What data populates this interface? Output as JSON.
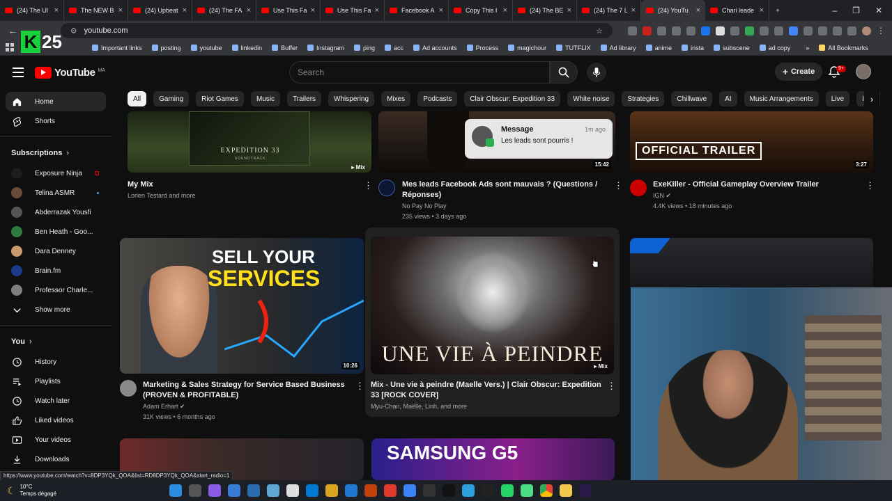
{
  "tabs": [
    {
      "title": "(24) The Ul"
    },
    {
      "title": "The NEW B"
    },
    {
      "title": "(24) Upbeat"
    },
    {
      "title": "(24) The FA"
    },
    {
      "title": "Use This Fa"
    },
    {
      "title": "Use This Fa"
    },
    {
      "title": "Facebook A"
    },
    {
      "title": "Copy This I"
    },
    {
      "title": "(24) The BE"
    },
    {
      "title": "(24) The 7 L"
    },
    {
      "title": "(24) YouTu"
    },
    {
      "title": "Chari leade"
    }
  ],
  "browser": {
    "url": "youtube.com",
    "new_tab": "+",
    "bookmarks": [
      "Important links",
      "posting",
      "youtube",
      "linkedin",
      "Buffer",
      "Instagram",
      "ping",
      "acc",
      "Ad accounts",
      "Process",
      "magichour",
      "TUTFLIX",
      "Ad library",
      "anime",
      "insta",
      "subscene",
      "ad copy"
    ],
    "all_bookmarks": "All Bookmarks",
    "more": "»"
  },
  "overlay": {
    "k": "K",
    "num": "25"
  },
  "youtube": {
    "logo": "YouTube",
    "country": "MA",
    "search_placeholder": "Search",
    "create": "Create",
    "notif_count": "9+"
  },
  "sidebar": {
    "home": "Home",
    "shorts": "Shorts",
    "subscriptions": "Subscriptions",
    "channels": [
      {
        "name": "Exposure Ninja",
        "color": "#1d1d1d"
      },
      {
        "name": "Telina ASMR",
        "color": "#6a4c3b"
      },
      {
        "name": "Abderrazak Yousfi",
        "color": "#555555"
      },
      {
        "name": "Ben Heath - Goo...",
        "color": "#2d7a3e"
      },
      {
        "name": "Dara Denney",
        "color": "#c89b6d"
      },
      {
        "name": "Brain.fm",
        "color": "#1b3a8a"
      },
      {
        "name": "Professor Charle...",
        "color": "#7d7d7d"
      }
    ],
    "show_more": "Show more",
    "you": "You",
    "history": "History",
    "playlists": "Playlists",
    "watch_later": "Watch later",
    "liked_videos": "Liked videos",
    "your_videos": "Your videos",
    "downloads": "Downloads"
  },
  "chips": [
    "All",
    "Gaming",
    "Riot Games",
    "Music",
    "Trailers",
    "Whispering",
    "Mixes",
    "Podcasts",
    "Clair Obscur: Expedition 33",
    "White noise",
    "Strategies",
    "Chillwave",
    "AI",
    "Music Arrangements",
    "Live",
    "Ideas"
  ],
  "videos": {
    "v1": {
      "title": "My Mix",
      "meta1": "Lorien Testard and more",
      "badge": "Mix",
      "thumb_text": "EXPEDITION 33",
      "thumb_sub": "SOUNDTRACK"
    },
    "v2": {
      "title": "Mes leads Facebook Ads sont mauvais ? (Questions / Réponses)",
      "channel": "No Pay No Play",
      "meta": "235 views • 3 days ago",
      "duration": "15:42"
    },
    "v3": {
      "title": "ExeKiller - Official Gameplay Overview Trailer",
      "channel": "IGN",
      "meta": "4.4K views • 18 minutes ago",
      "duration": "3:27",
      "thumb_text": "OFFICIAL TRAILER"
    },
    "v4": {
      "title": "Marketing & Sales Strategy for Service Based Business (PROVEN & PROFITABLE)",
      "channel": "Adam Erhart",
      "meta": "31K views • 6 months ago",
      "duration": "10:26",
      "thumb_line1": "SELL YOUR",
      "thumb_line2": "SERVICES"
    },
    "v5": {
      "title": "Mix - Une vie à peindre (Maelle Vers.) | Clair Obscur: Expedition 33 [ROCK COVER]",
      "meta": "Myu-Chan, Maëlle, Linh, and more",
      "badge": "Mix",
      "thumb_text": "UNE VIE À PEINDRE"
    },
    "v7": {
      "thumb_text": "SAMSUNG G5"
    }
  },
  "toast": {
    "title": "Message",
    "body": "Les leads sont pourris !",
    "time": "1m ago"
  },
  "status_url": "https://www.youtube.com/watch?v=8DP3YQk_QOA&list=RD8DP3YQk_QOA&start_radio=1",
  "taskbar": {
    "temp": "10°C",
    "weather": "Temps dégagé"
  },
  "colors": {
    "brand": "#ff0000",
    "bg": "#0f0f0f",
    "chip_active": "#f1f1f1",
    "accent": "#3ea6ff"
  }
}
